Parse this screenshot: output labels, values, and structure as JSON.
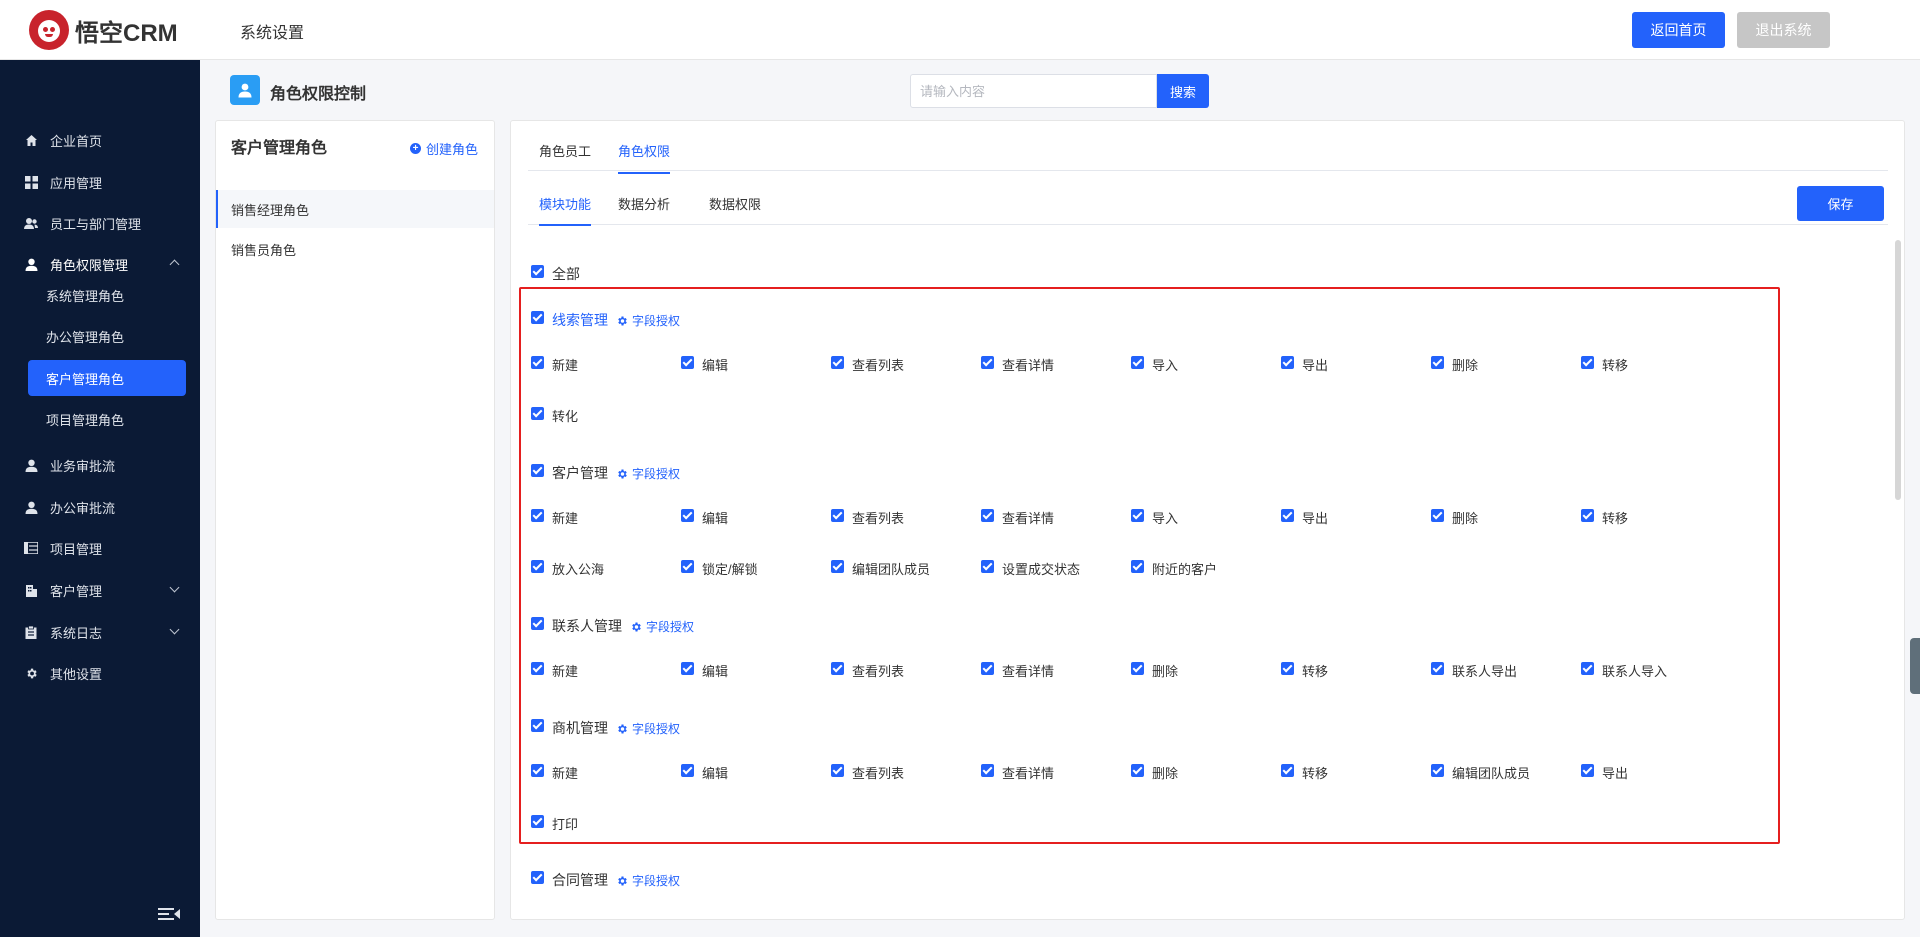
{
  "header": {
    "logo_text": "悟空CRM",
    "title": "系统设置",
    "home_button": "返回首页",
    "exit_button": "退出系统"
  },
  "sidebar": {
    "items": [
      {
        "label": "企业首页",
        "icon": "home-icon"
      },
      {
        "label": "应用管理",
        "icon": "grid-icon"
      },
      {
        "label": "员工与部门管理",
        "icon": "users-icon"
      },
      {
        "label": "角色权限管理",
        "icon": "user-icon"
      },
      {
        "label": "业务审批流",
        "icon": "user-icon"
      },
      {
        "label": "办公审批流",
        "icon": "user-icon"
      },
      {
        "label": "项目管理",
        "icon": "list-icon"
      },
      {
        "label": "客户管理",
        "icon": "building-icon"
      },
      {
        "label": "系统日志",
        "icon": "clipboard-icon"
      },
      {
        "label": "其他设置",
        "icon": "gear-icon"
      }
    ],
    "sub_items": [
      "系统管理角色",
      "办公管理角色",
      "客户管理角色",
      "项目管理角色"
    ],
    "active_sub": "客户管理角色"
  },
  "page": {
    "title": "角色权限控制",
    "search_placeholder": "请输入内容",
    "search_button": "搜索"
  },
  "roles": {
    "title": "客户管理角色",
    "create": "创建角色",
    "items": [
      "销售经理角色",
      "销售员角色"
    ]
  },
  "tabs": [
    "角色员工",
    "角色权限"
  ],
  "subtabs": [
    "模块功能",
    "数据分析",
    "数据权限"
  ],
  "save": "保存",
  "perm": {
    "all": "全部",
    "field_auth": "字段授权",
    "groups": [
      {
        "name": "线索管理",
        "row1": [
          "新建",
          "编辑",
          "查看列表",
          "查看详情",
          "导入",
          "导出",
          "删除",
          "转移"
        ],
        "row2": [
          "转化"
        ]
      },
      {
        "name": "客户管理",
        "row1": [
          "新建",
          "编辑",
          "查看列表",
          "查看详情",
          "导入",
          "导出",
          "删除",
          "转移"
        ],
        "row2": [
          "放入公海",
          "锁定/解锁",
          "编辑团队成员",
          "设置成交状态",
          "附近的客户"
        ]
      },
      {
        "name": "联系人管理",
        "row1": [
          "新建",
          "编辑",
          "查看列表",
          "查看详情",
          "删除",
          "转移",
          "联系人导出",
          "联系人导入"
        ],
        "row2": []
      },
      {
        "name": "商机管理",
        "row1": [
          "新建",
          "编辑",
          "查看列表",
          "查看详情",
          "删除",
          "转移",
          "编辑团队成员",
          "导出"
        ],
        "row2": [
          "打印"
        ]
      },
      {
        "name": "合同管理",
        "row1": [],
        "row2": []
      }
    ]
  },
  "colors": {
    "primary": "#2362fb",
    "sidebar_bg": "#0b1a35",
    "highlight": "#e51f1f"
  }
}
